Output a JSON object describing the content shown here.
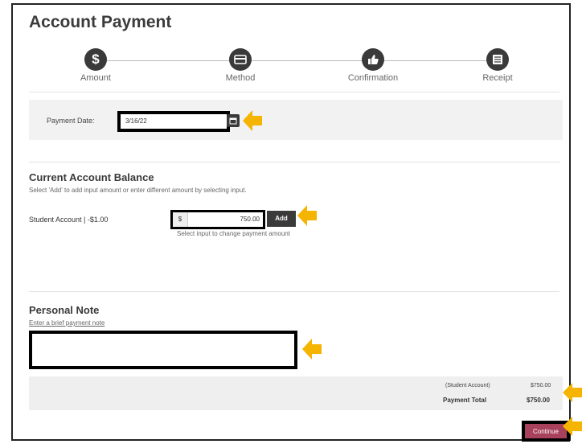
{
  "page": {
    "title": "Account Payment"
  },
  "steps": [
    {
      "label": "Amount",
      "icon": "dollar-icon"
    },
    {
      "label": "Method",
      "icon": "card-icon"
    },
    {
      "label": "Confirmation",
      "icon": "thumbs-up-icon"
    },
    {
      "label": "Receipt",
      "icon": "receipt-icon"
    }
  ],
  "payment_date": {
    "label": "Payment Date:",
    "value": "3/16/22"
  },
  "balance": {
    "title": "Current Account Balance",
    "hint": "Select 'Add' to add input amount or enter different amount by selecting input.",
    "account_label": "Student Account | -$1.00",
    "currency": "$",
    "amount": "750.00",
    "add_label": "Add",
    "input_hint": "Select input to change payment amount"
  },
  "note": {
    "title": "Personal Note",
    "hint": "Enter a brief payment note",
    "value": ""
  },
  "totals": {
    "line_label": "(Student Account)",
    "line_value": "$750.00",
    "total_label": "Payment Total",
    "total_value": "$750.00"
  },
  "actions": {
    "continue_label": "Continue"
  },
  "colors": {
    "accent": "#a8415c",
    "arrow": "#f5b400",
    "step": "#3a3a3a"
  }
}
